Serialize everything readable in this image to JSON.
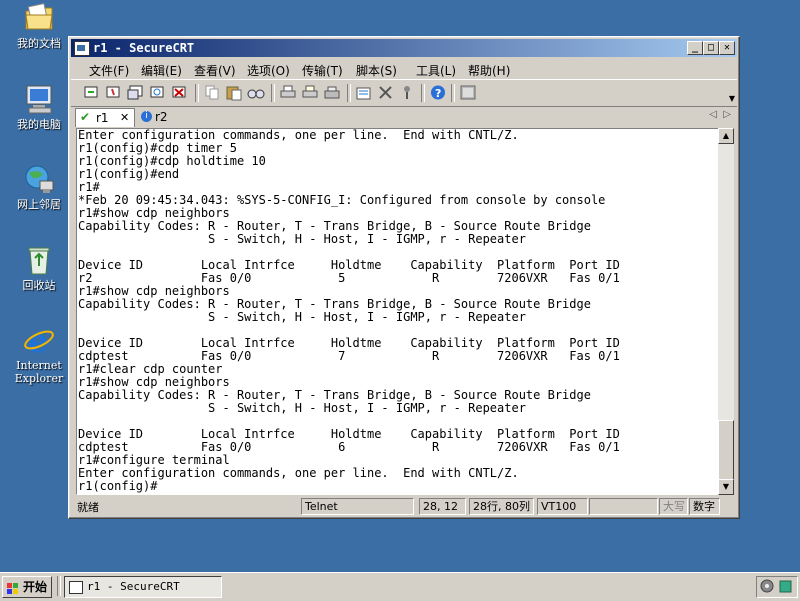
{
  "desktop": {
    "icons": [
      {
        "label": "我的文档"
      },
      {
        "label": "我的电脑"
      },
      {
        "label": "网上邻居"
      },
      {
        "label": "回收站"
      },
      {
        "label_line1": "Internet",
        "label_line2": "Explorer"
      }
    ]
  },
  "window": {
    "title": "r1 - SecureCRT",
    "menus": [
      "文件(F)",
      "编辑(E)",
      "查看(V)",
      "选项(O)",
      "传输(T)",
      "脚本(S)",
      "工具(L)",
      "帮助(H)"
    ],
    "tabs": [
      {
        "label": "r1",
        "close": "✕"
      },
      {
        "label": "r2"
      }
    ],
    "terminal_lines": [
      "Enter configuration commands, one per line.  End with CNTL/Z.",
      "r1(config)#cdp timer 5",
      "r1(config)#cdp holdtime 10",
      "r1(config)#end",
      "r1#",
      "*Feb 20 09:45:34.043: %SYS-5-CONFIG_I: Configured from console by console",
      "r1#show cdp neighbors",
      "Capability Codes: R - Router, T - Trans Bridge, B - Source Route Bridge",
      "                  S - Switch, H - Host, I - IGMP, r - Repeater",
      "",
      "Device ID        Local Intrfce     Holdtme    Capability  Platform  Port ID",
      "r2               Fas 0/0            5            R        7206VXR   Fas 0/1",
      "r1#show cdp neighbors",
      "Capability Codes: R - Router, T - Trans Bridge, B - Source Route Bridge",
      "                  S - Switch, H - Host, I - IGMP, r - Repeater",
      "",
      "Device ID        Local Intrfce     Holdtme    Capability  Platform  Port ID",
      "cdptest          Fas 0/0            7            R        7206VXR   Fas 0/1",
      "r1#clear cdp counter",
      "r1#show cdp neighbors",
      "Capability Codes: R - Router, T - Trans Bridge, B - Source Route Bridge",
      "                  S - Switch, H - Host, I - IGMP, r - Repeater",
      "",
      "Device ID        Local Intrfce     Holdtme    Capability  Platform  Port ID",
      "cdptest          Fas 0/0            6            R        7206VXR   Fas 0/1",
      "r1#configure terminal",
      "Enter configuration commands, one per line.  End with CNTL/Z.",
      "r1(config)#"
    ],
    "status": {
      "ready": "就绪",
      "protocol": "Telnet",
      "cursor": "28, 12",
      "size": "28行, 80列",
      "emulation": "VT100",
      "caps": "大写",
      "num": "数字"
    }
  },
  "taskbar": {
    "start": "开始",
    "task": "r1 - SecureCRT"
  }
}
